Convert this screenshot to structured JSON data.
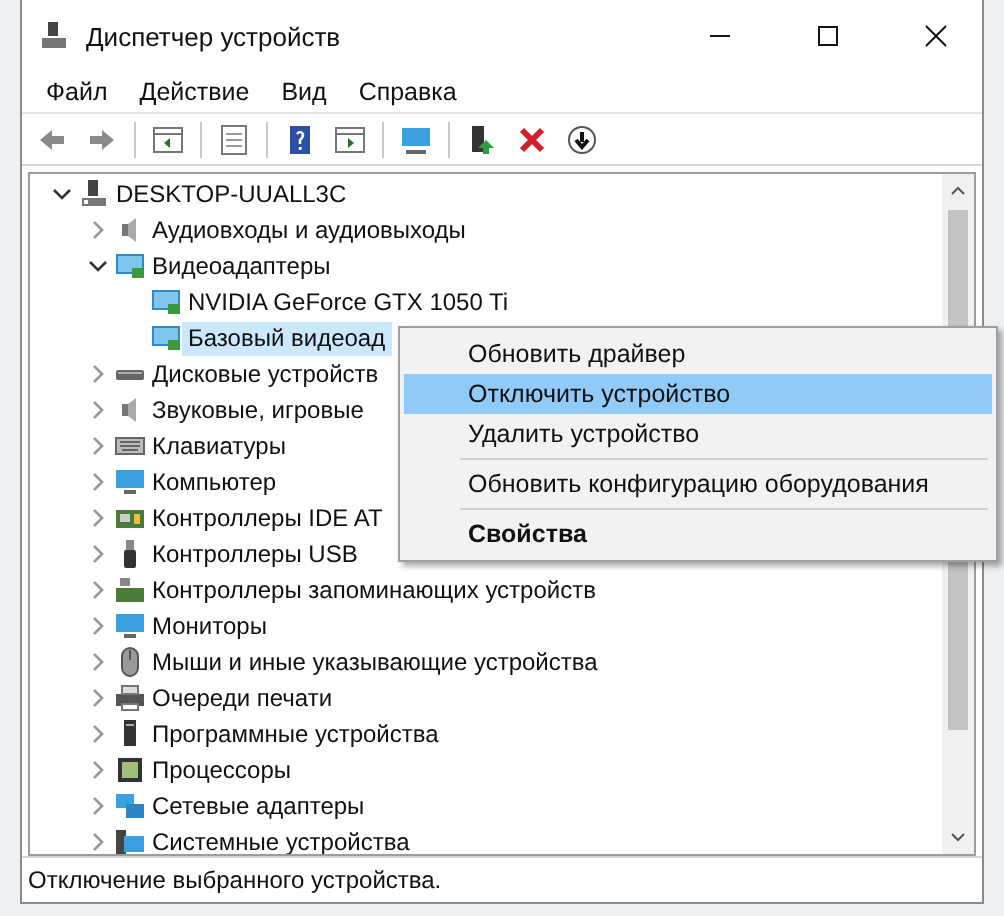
{
  "window": {
    "title": "Диспетчер устройств"
  },
  "menu_bar": [
    "Файл",
    "Действие",
    "Вид",
    "Справка"
  ],
  "tree": [
    {
      "label": "DESKTOP-UUALL3C",
      "expanded": true,
      "selected": false,
      "children": [
        {
          "label": "Аудиовходы и аудиовыходы",
          "expanded": false,
          "selected": false
        },
        {
          "label": "Видеоадаптеры",
          "expanded": true,
          "selected": false,
          "children": [
            {
              "label": "NVIDIA GeForce GTX 1050 Ti",
              "selected": false
            },
            {
              "label": "Базовый видеоад",
              "selected": true
            }
          ]
        },
        {
          "label": "Дисковые устройств",
          "expanded": false,
          "selected": false
        },
        {
          "label": "Звуковые, игровые",
          "expanded": false,
          "selected": false
        },
        {
          "label": "Клавиатуры",
          "expanded": false,
          "selected": false
        },
        {
          "label": "Компьютер",
          "expanded": false,
          "selected": false
        },
        {
          "label": "Контроллеры IDE AT",
          "expanded": false,
          "selected": false
        },
        {
          "label": "Контроллеры USB",
          "expanded": false,
          "selected": false
        },
        {
          "label": "Контроллеры запоминающих устройств",
          "expanded": false,
          "selected": false
        },
        {
          "label": "Мониторы",
          "expanded": false,
          "selected": false
        },
        {
          "label": "Мыши и иные указывающие устройства",
          "expanded": false,
          "selected": false
        },
        {
          "label": "Очереди печати",
          "expanded": false,
          "selected": false
        },
        {
          "label": "Программные устройства",
          "expanded": false,
          "selected": false
        },
        {
          "label": "Процессоры",
          "expanded": false,
          "selected": false
        },
        {
          "label": "Сетевые адаптеры",
          "expanded": false,
          "selected": false
        },
        {
          "label": "Системные устройства",
          "expanded": false,
          "selected": false
        }
      ]
    }
  ],
  "context_menu": [
    {
      "kind": "item",
      "label": "Обновить драйвер",
      "selected": false
    },
    {
      "kind": "item",
      "label": "Отключить устройство",
      "selected": true
    },
    {
      "kind": "item",
      "label": "Удалить устройство",
      "selected": false
    },
    {
      "kind": "separator"
    },
    {
      "kind": "item",
      "label": "Обновить конфигурацию оборудования",
      "selected": false
    },
    {
      "kind": "separator"
    },
    {
      "kind": "default",
      "label": "Свойства",
      "selected": false
    }
  ],
  "status_bar": "Отключение выбранного устройства."
}
